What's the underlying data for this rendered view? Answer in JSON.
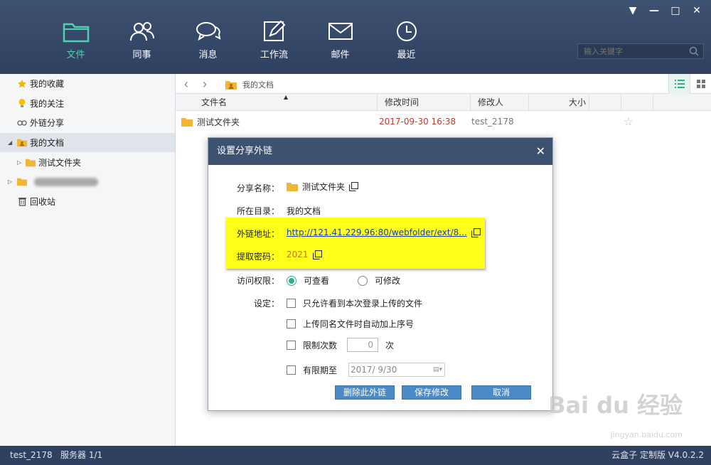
{
  "window_controls": [
    "▼",
    "—",
    "□",
    "✕"
  ],
  "nav": [
    {
      "label": "文件",
      "icon": "folder-icon",
      "active": true
    },
    {
      "label": "同事",
      "icon": "people-icon"
    },
    {
      "label": "消息",
      "icon": "chat-icon"
    },
    {
      "label": "工作流",
      "icon": "edit-icon"
    },
    {
      "label": "邮件",
      "icon": "mail-icon"
    },
    {
      "label": "最近",
      "icon": "clock-icon"
    }
  ],
  "search": {
    "placeholder": "输入关键字"
  },
  "sidebar": {
    "items": [
      {
        "label": "我的收藏",
        "icon": "star-icon"
      },
      {
        "label": "我的关注",
        "icon": "bulb-icon"
      },
      {
        "label": "外链分享",
        "icon": "link-icon"
      },
      {
        "label": "我的文档",
        "icon": "my-folder-icon"
      },
      {
        "label": "测试文件夹",
        "icon": "folder-icon"
      },
      {
        "label": "",
        "icon": "folder-icon"
      },
      {
        "label": "回收站",
        "icon": "trash-icon"
      }
    ]
  },
  "path": {
    "current": "我的文档"
  },
  "table": {
    "headers": [
      "文件名",
      "修改时间",
      "修改人",
      "大小"
    ],
    "rows": [
      {
        "name": "测试文件夹",
        "time": "2017-09-30 16:38",
        "modifier": "test_2178"
      }
    ]
  },
  "dialog": {
    "title": "设置分享外链",
    "share_name_label": "分享名称：",
    "share_name": "测试文件夹",
    "dir_label": "所在目录：",
    "dir": "我的文档",
    "link_label": "外链地址：",
    "link": "http://121.41.229.96:80/webfolder/ext/8...",
    "pw_label": "提取密码：",
    "pw": "2021",
    "perm_label": "访问权限：",
    "perm_view": "可查看",
    "perm_edit": "可修改",
    "settings_label": "设定：",
    "opt1": "只允许看到本次登录上传的文件",
    "opt2": "上传同名文件时自动加上序号",
    "opt3": "限制次数",
    "opt3_value": "0",
    "opt3_unit": "次",
    "opt4": "有限期至",
    "opt4_date": "2017/ 9/30",
    "btn_delete": "删除此外链",
    "btn_save": "保存修改",
    "btn_cancel": "取消"
  },
  "status": {
    "left": "test_2178   服务器 1/1",
    "right": "云盒子 定制版 V4.0.2.2"
  },
  "watermark": {
    "main": "Bai du 经验",
    "sub": "jingyan.baidu.com"
  },
  "colors": {
    "header": "#3d5171",
    "accent": "#4fd1b0",
    "highlight": "#ffff1a",
    "button": "#4a8ac6"
  }
}
